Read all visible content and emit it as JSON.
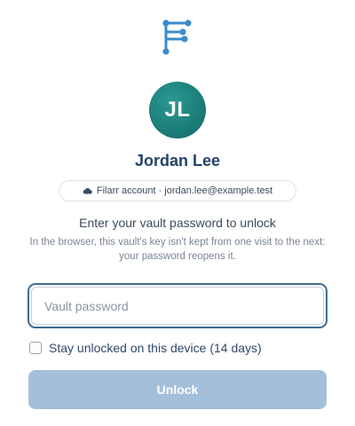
{
  "brand": {
    "logo_icon": "filarr-logo-icon",
    "accent_color": "#3a8ccc"
  },
  "user": {
    "initials": "JL",
    "name": "Jordan Lee",
    "avatar_color": "#1d7f7a",
    "account_icon": "cloud-icon",
    "account_label": "Filarr account · jordan.lee@example.test"
  },
  "unlock_form": {
    "instruction": "Enter your vault password to unlock",
    "note": "In the browser, this vault's key isn't kept from one visit to the next: your password reopens it.",
    "password_value": "",
    "password_placeholder": "Vault password",
    "remember_label": "Stay unlocked on this device (14 days)",
    "remember_checked": false,
    "unlock_label": "Unlock",
    "unlock_enabled": false,
    "unlock_button_color": "#a4bfda",
    "input_focus_color": "#3f6a91"
  }
}
